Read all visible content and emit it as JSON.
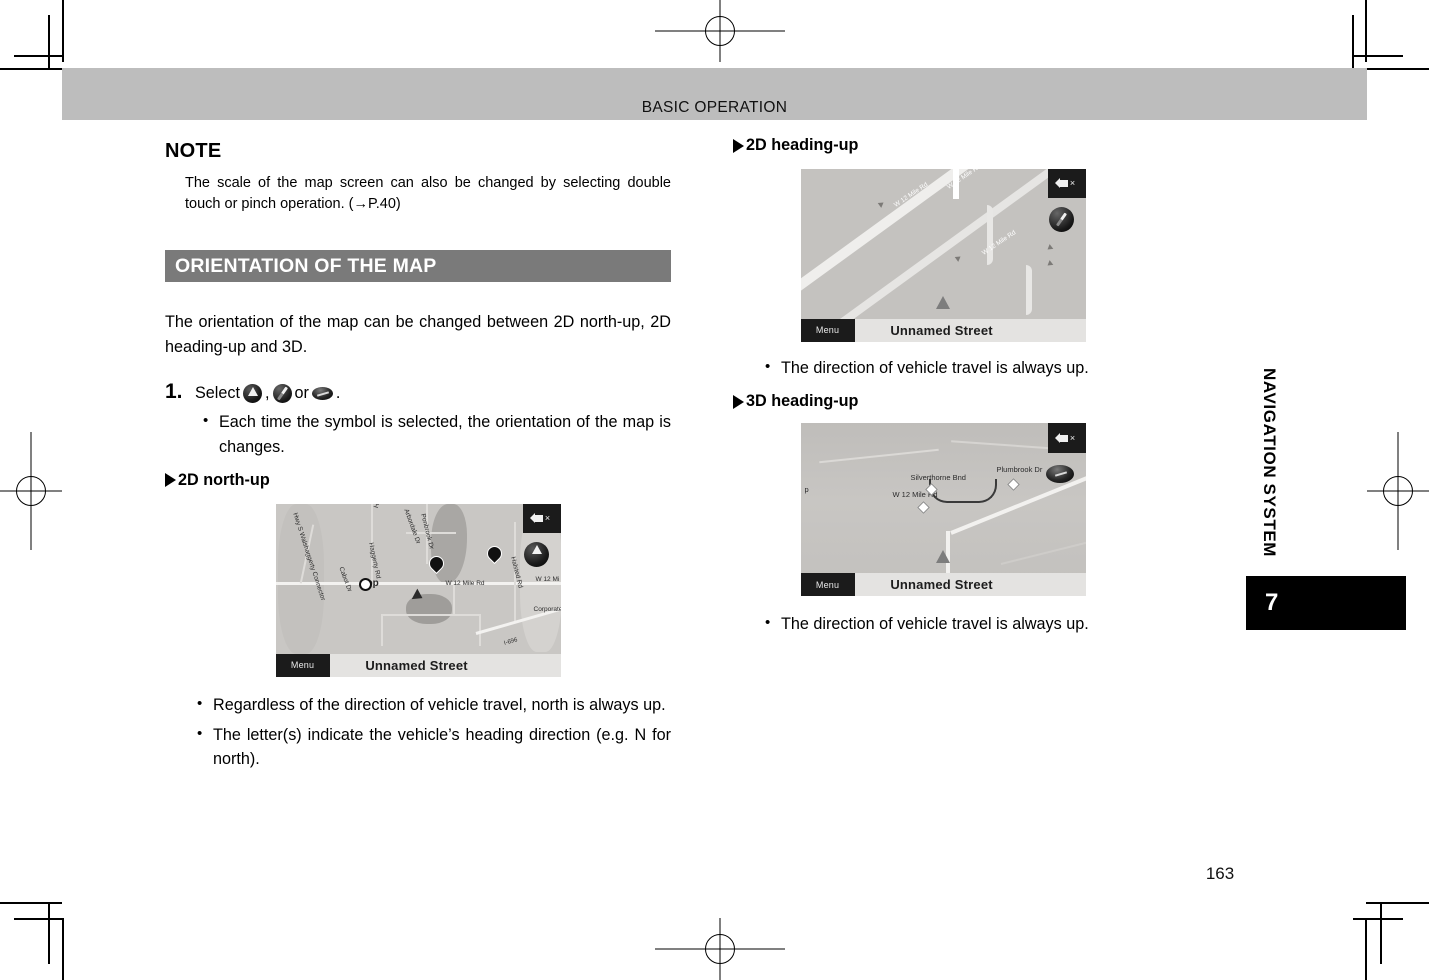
{
  "header": {
    "title": "BASIC OPERATION"
  },
  "sidebar": {
    "vertical_label": "NAVIGATION SYSTEM",
    "chapter_number": "7"
  },
  "footer": {
    "page_number": "163"
  },
  "left_column": {
    "note": {
      "title": "NOTE",
      "body": "The scale of the map screen can also be changed by selecting double touch or pinch operation. (→P.40)"
    },
    "section_heading": "ORIENTATION OF THE MAP",
    "intro": "The orientation of the map can be changed between 2D north-up, 2D heading-up and 3D.",
    "step": {
      "number": "1.",
      "text_before": "Select",
      "comma": ",",
      "or_word": "or",
      "period": ".",
      "icon_1": "map-north-up-icon",
      "icon_2": "map-heading-up-icon",
      "icon_3": "map-3d-icon"
    },
    "step_bullets": [
      "Each time the symbol is selected, the orientation of the map is changes."
    ],
    "subhead_2d_north_up": "2D north-up",
    "bullets_2d_north_up": [
      "Regardless of the direction of vehicle travel, north is always up.",
      "The letter(s) indicate the vehicle’s heading direction (e.g. N for north)."
    ],
    "map_2d_north_up": {
      "menu_label": "Menu",
      "street_name": "Unnamed Street",
      "mute_icon": "mute-speaker-icon",
      "compass_icon": "north-up-compass-icon",
      "labels": [
        "Hwy S Walkhaggerty Connector",
        "Cabot Dr",
        "Haggerty Rd",
        "Halsted Rd",
        "Arbordale Dr",
        "Ponbrook Dr",
        "W 12 Mile Rd",
        "W 12 Mi",
        "Haggerty Rd",
        "Corporate",
        "I-696",
        "bp"
      ]
    }
  },
  "right_column": {
    "subhead_2d_heading_up": "2D heading-up",
    "bullets_2d_heading_up": [
      "The direction of vehicle travel is always up."
    ],
    "map_2d_heading_up": {
      "menu_label": "Menu",
      "street_name": "Unnamed Street",
      "mute_icon": "mute-speaker-icon",
      "compass_icon": "heading-up-compass-icon",
      "labels": [
        "W 12 Mile Rd",
        "W 12 Mile Rd",
        "W 12 Mile Rd"
      ]
    },
    "subhead_3d_heading_up": "3D heading-up",
    "bullets_3d_heading_up": [
      "The direction of vehicle travel is always up."
    ],
    "map_3d_heading_up": {
      "menu_label": "Menu",
      "street_name": "Unnamed Street",
      "mute_icon": "mute-speaker-icon",
      "compass_icon": "3d-view-icon",
      "labels": [
        "Silverthorne Bnd",
        "Plumbrook Dr",
        "W 12 Mile Rd",
        "p"
      ]
    }
  },
  "colors": {
    "header_band": "#bdbdbd",
    "section_bar": "#7a7a7a",
    "chapter_tab": "#000000",
    "map_background": "#c9c7c4"
  }
}
